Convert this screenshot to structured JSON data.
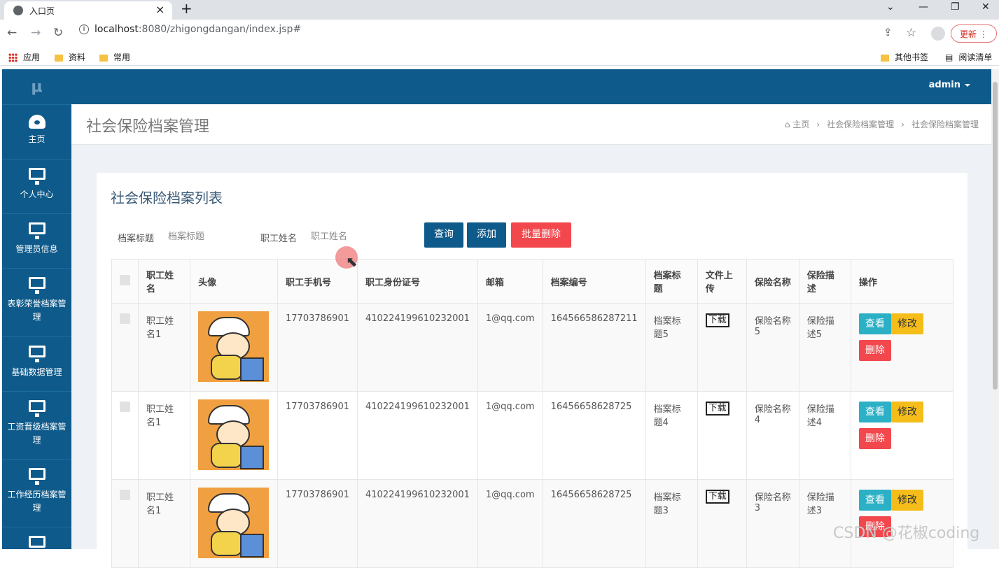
{
  "browser": {
    "tab_title": "入口页",
    "tab_close": "×",
    "new_tab": "+",
    "url_host": "localhost",
    "url_path": ":8080/zhigongdangan/index.jsp#",
    "update_label": "更新",
    "bookmarks": [
      "应用",
      "资料",
      "常用"
    ],
    "other_bookmarks": "其他书签",
    "reading_list": "阅读清单"
  },
  "app": {
    "logo": "μ",
    "user": "admin",
    "sidebar": [
      {
        "label": "主页",
        "icon": "dashboard-icon"
      },
      {
        "label": "个人中心",
        "icon": "monitor-icon"
      },
      {
        "label": "管理员信息",
        "icon": "monitor-icon"
      },
      {
        "label": "表彰荣誉档案管理",
        "icon": "monitor-icon"
      },
      {
        "label": "基础数据管理",
        "icon": "monitor-icon"
      },
      {
        "label": "工资晋级档案管理",
        "icon": "monitor-icon"
      },
      {
        "label": "工作经历档案管理",
        "icon": "monitor-icon"
      }
    ],
    "page_title": "社会保险档案管理",
    "breadcrumb": [
      "主页",
      "社会保险档案管理",
      "社会保险档案管理"
    ]
  },
  "panel": {
    "title": "社会保险档案列表",
    "search": {
      "archive_title_label": "档案标题",
      "archive_title_placeholder": "档案标题",
      "name_label": "职工姓名",
      "name_placeholder": "职工姓名"
    },
    "buttons": {
      "query": "查询",
      "add": "添加",
      "batch_delete": "批量删除"
    },
    "columns": [
      "职工姓名",
      "头像",
      "职工手机号",
      "职工身份证号",
      "邮箱",
      "档案编号",
      "档案标题",
      "文件上传",
      "保险名称",
      "保险描述",
      "操作"
    ],
    "rows": [
      {
        "name": "职工姓名1",
        "phone": "17703786901",
        "id_card": "410224199610232001",
        "email": "1@qq.com",
        "archive_no": "164566586287211",
        "archive_title": "档案标题5",
        "file": "下载",
        "ins_name": "保险名称5",
        "ins_desc": "保险描述5"
      },
      {
        "name": "职工姓名1",
        "phone": "17703786901",
        "id_card": "410224199610232001",
        "email": "1@qq.com",
        "archive_no": "16456658628725",
        "archive_title": "档案标题4",
        "file": "下载",
        "ins_name": "保险名称4",
        "ins_desc": "保险描述4"
      },
      {
        "name": "职工姓名1",
        "phone": "17703786901",
        "id_card": "410224199610232001",
        "email": "1@qq.com",
        "archive_no": "16456658628725",
        "archive_title": "档案标题3",
        "file": "下载",
        "ins_name": "保险名称3",
        "ins_desc": "保险描述3"
      }
    ],
    "row_actions": {
      "view": "查看",
      "edit": "修改",
      "delete": "删除"
    }
  },
  "watermark": "CSDN @花椒coding",
  "colors": {
    "brand": "#0e5a8a",
    "danger": "#f2474d",
    "info": "#2bb0c5",
    "warning": "#f5bd1a"
  }
}
